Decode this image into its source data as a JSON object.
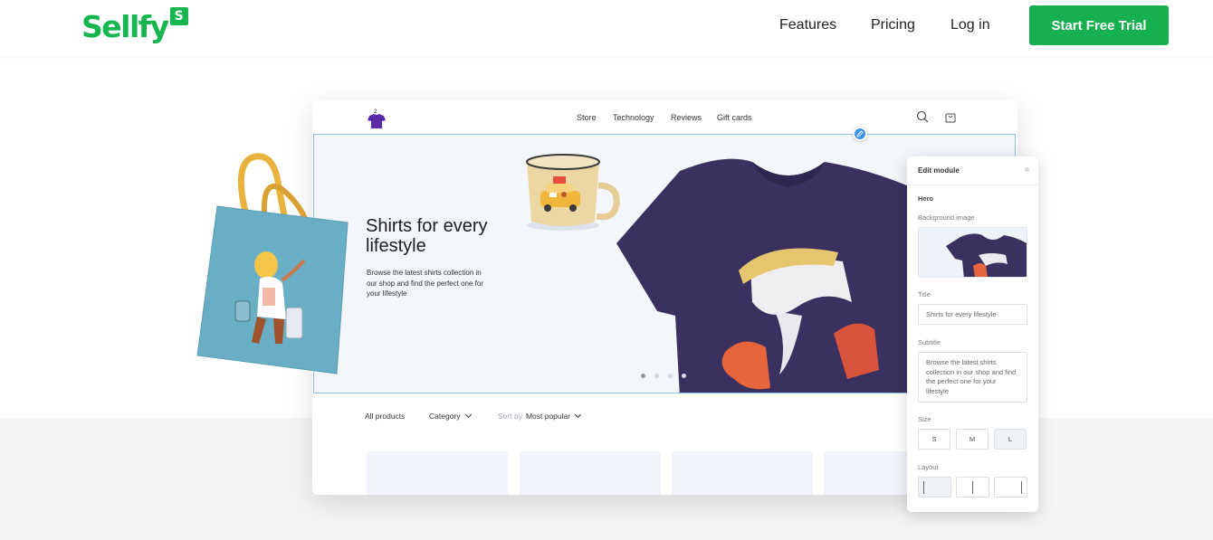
{
  "header": {
    "logo_text": "Sellfy",
    "logo_badge": "S",
    "nav": [
      {
        "label": "Features"
      },
      {
        "label": "Pricing"
      },
      {
        "label": "Log in"
      }
    ],
    "cta_label": "Start Free Trial"
  },
  "store": {
    "nav": [
      "Store",
      "Technology",
      "Reviews",
      "Gift cards"
    ],
    "hero": {
      "title": "Shirts for every lifestyle",
      "subtitle": "Browse the latest shirts collection in our shop and find the perfect one for your lifestyle",
      "slide_count": 4,
      "active_slide": 1
    },
    "filters": {
      "all_products": "All products",
      "category": "Category",
      "sort_label": "Sort by",
      "sort_value": "Most popular"
    }
  },
  "edit_panel": {
    "title": "Edit module",
    "section": "Hero",
    "background_label": "Background image",
    "title_label": "Title",
    "title_value": "Shirts for every lifestyle",
    "subtitle_label": "Subtitle",
    "subtitle_value": "Browse the latest shirts collection in our shop and find the perfect one for your lifestyle",
    "size_label": "Size",
    "sizes": [
      "S",
      "M",
      "L"
    ],
    "selected_size": "L",
    "layout_label": "Layout",
    "selected_layout": 1
  },
  "colors": {
    "brand_green": "#17b04f",
    "accent_blue": "#3b92e8",
    "shirt_navy": "#3b3160"
  }
}
